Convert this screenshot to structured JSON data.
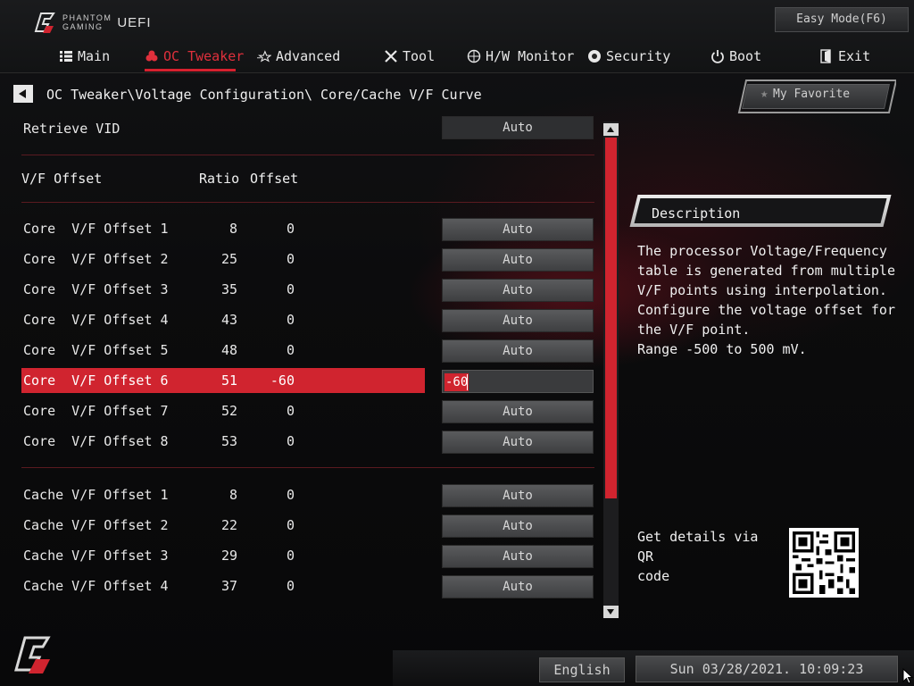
{
  "header": {
    "brand_line1": "PHANTOM",
    "brand_line2": "GAMING",
    "brand_uefi": "UEFI",
    "easy_mode_label": "Easy Mode(F6)",
    "accent_color": "#d0242f"
  },
  "nav": {
    "items": [
      {
        "label": "Main",
        "icon": "list-icon"
      },
      {
        "label": "OC Tweaker",
        "icon": "flame-icon",
        "active": true
      },
      {
        "label": "Advanced",
        "icon": "star-icon"
      },
      {
        "label": "Tool",
        "icon": "wrench-icon"
      },
      {
        "label": "H/W Monitor",
        "icon": "monitor-icon"
      },
      {
        "label": "Security",
        "icon": "shield-icon"
      },
      {
        "label": "Boot",
        "icon": "power-icon"
      },
      {
        "label": "Exit",
        "icon": "exit-icon"
      }
    ]
  },
  "breadcrumb": "OC Tweaker\\Voltage Configuration\\ Core/Cache V/F Curve",
  "favorite_label": "My Favorite",
  "settings": {
    "retrieve_vid": {
      "label": "Retrieve VID",
      "value": "Auto"
    },
    "header": {
      "col1": "V/F Offset",
      "col2": "Ratio",
      "col3": "Offset"
    },
    "core_rows": [
      {
        "label": "Core  V/F Offset 1",
        "ratio": "8",
        "offset": "0",
        "value": "Auto"
      },
      {
        "label": "Core  V/F Offset 2",
        "ratio": "25",
        "offset": "0",
        "value": "Auto"
      },
      {
        "label": "Core  V/F Offset 3",
        "ratio": "35",
        "offset": "0",
        "value": "Auto"
      },
      {
        "label": "Core  V/F Offset 4",
        "ratio": "43",
        "offset": "0",
        "value": "Auto"
      },
      {
        "label": "Core  V/F Offset 5",
        "ratio": "48",
        "offset": "0",
        "value": "Auto"
      },
      {
        "label": "Core  V/F Offset 6",
        "ratio": "51",
        "offset": "-60",
        "value": "-60",
        "selected": true
      },
      {
        "label": "Core  V/F Offset 7",
        "ratio": "52",
        "offset": "0",
        "value": "Auto"
      },
      {
        "label": "Core  V/F Offset 8",
        "ratio": "53",
        "offset": "0",
        "value": "Auto"
      }
    ],
    "cache_rows": [
      {
        "label": "Cache V/F Offset 1",
        "ratio": "8",
        "offset": "0",
        "value": "Auto"
      },
      {
        "label": "Cache V/F Offset 2",
        "ratio": "22",
        "offset": "0",
        "value": "Auto"
      },
      {
        "label": "Cache V/F Offset 3",
        "ratio": "29",
        "offset": "0",
        "value": "Auto"
      },
      {
        "label": "Cache V/F Offset 4",
        "ratio": "37",
        "offset": "0",
        "value": "Auto"
      }
    ]
  },
  "description": {
    "title": "Description",
    "lines": [
      "The processor Voltage/Frequency",
      "table is generated from multiple",
      "V/F points using interpolation.",
      "Configure the voltage offset for",
      "the V/F point.",
      "Range -500 to 500 mV."
    ],
    "qr_label_1": "Get details via QR",
    "qr_label_2": "code"
  },
  "footer": {
    "language": "English",
    "datetime": "Sun 03/28/2021. 10:09:23"
  }
}
